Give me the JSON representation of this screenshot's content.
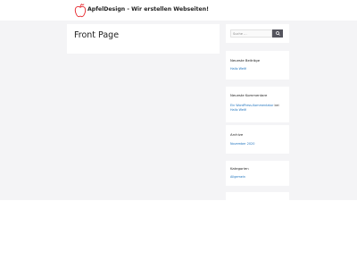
{
  "header": {
    "site_title": "ApfelDesign - Wir erstellen Webseiten!"
  },
  "main": {
    "page_title": "Front Page"
  },
  "sidebar": {
    "search": {
      "placeholder": "Suche ...",
      "button_icon": "search-icon"
    },
    "recent_posts": {
      "title": "Neueste Beiträge",
      "items": [
        "Hallo Welt!"
      ]
    },
    "recent_comments": {
      "title": "Neueste Kommentare",
      "author": "Ein WordPress-Kommentator",
      "connector": "bei",
      "post": "Hallo Welt!"
    },
    "archive": {
      "title": "Archive",
      "items": [
        "November 2020"
      ]
    },
    "categories": {
      "title": "Kategorien",
      "items": [
        "Allgemein"
      ]
    }
  },
  "colors": {
    "link": "#1e73be",
    "content_background": "#f4f4f6",
    "search_button": "#55555e",
    "logo": "#e8353a"
  }
}
